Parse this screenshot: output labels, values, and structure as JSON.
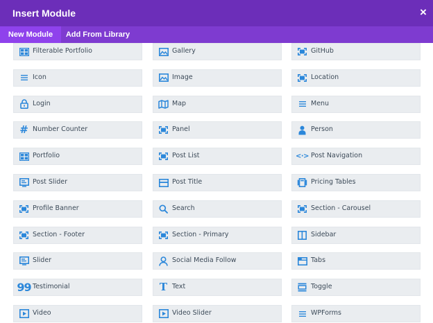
{
  "colors": {
    "header_bg": "#6c2eb9",
    "tabbar_bg": "#7e3bd0",
    "tab_active_bg": "#8f42ec",
    "item_bg": "#eaedf0",
    "icon_color": "#2b87da",
    "label_color": "#3c4a58"
  },
  "modal": {
    "title": "Insert Module",
    "close_glyph": "×"
  },
  "tabs": [
    {
      "label": "New Module",
      "active": true
    },
    {
      "label": "Add From Library",
      "active": false
    }
  ],
  "modules": [
    {
      "label": "Filterable Portfolio",
      "icon": "grid-icon"
    },
    {
      "label": "Gallery",
      "icon": "image-icon"
    },
    {
      "label": "GitHub",
      "icon": "module-icon"
    },
    {
      "label": "Icon",
      "icon": "lines-icon"
    },
    {
      "label": "Image",
      "icon": "image-icon"
    },
    {
      "label": "Location",
      "icon": "module-icon"
    },
    {
      "label": "Login",
      "icon": "lock-icon"
    },
    {
      "label": "Map",
      "icon": "map-icon"
    },
    {
      "label": "Menu",
      "icon": "lines-icon"
    },
    {
      "label": "Number Counter",
      "icon": "hash-icon"
    },
    {
      "label": "Panel",
      "icon": "module-icon"
    },
    {
      "label": "Person",
      "icon": "person-icon"
    },
    {
      "label": "Portfolio",
      "icon": "grid-icon"
    },
    {
      "label": "Post List",
      "icon": "module-icon"
    },
    {
      "label": "Post Navigation",
      "icon": "code-icon"
    },
    {
      "label": "Post Slider",
      "icon": "slider-icon"
    },
    {
      "label": "Post Title",
      "icon": "title-icon"
    },
    {
      "label": "Pricing Tables",
      "icon": "pricing-icon"
    },
    {
      "label": "Profile Banner",
      "icon": "module-icon"
    },
    {
      "label": "Search",
      "icon": "search-icon"
    },
    {
      "label": "Section - Carousel",
      "icon": "module-icon"
    },
    {
      "label": "Section - Footer",
      "icon": "module-icon"
    },
    {
      "label": "Section - Primary",
      "icon": "module-icon"
    },
    {
      "label": "Sidebar",
      "icon": "sidebar-icon"
    },
    {
      "label": "Slider",
      "icon": "slider-icon"
    },
    {
      "label": "Social Media Follow",
      "icon": "person-outline-icon"
    },
    {
      "label": "Tabs",
      "icon": "tabs-icon"
    },
    {
      "label": "Testimonial",
      "icon": "quote-icon"
    },
    {
      "label": "Text",
      "icon": "text-icon"
    },
    {
      "label": "Toggle",
      "icon": "toggle-icon"
    },
    {
      "label": "Video",
      "icon": "video-icon"
    },
    {
      "label": "Video Slider",
      "icon": "video-icon"
    },
    {
      "label": "WPForms",
      "icon": "lines-icon"
    }
  ]
}
